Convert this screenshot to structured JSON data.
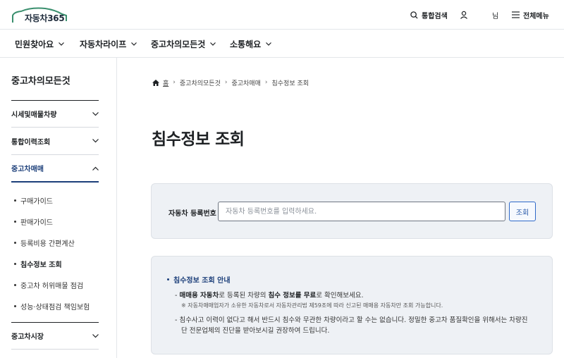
{
  "header": {
    "logo_text": "자동차365",
    "search_label": "통합검색",
    "user_name": "님",
    "menu_label": "전체메뉴"
  },
  "gnb": {
    "items": [
      {
        "label": "민원찾아요"
      },
      {
        "label": "자동차라이프"
      },
      {
        "label": "중고차의모든것"
      },
      {
        "label": "소통해요"
      }
    ]
  },
  "sidebar": {
    "title": "중고차의모든것",
    "sections": [
      {
        "label": "시세및매물차량"
      },
      {
        "label": "통합이력조회"
      },
      {
        "label": "중고차매매"
      },
      {
        "label": "중고차시장"
      }
    ],
    "sub_items": [
      {
        "label": "구매가이드"
      },
      {
        "label": "판매가이드"
      },
      {
        "label": "등록비용 간편계산"
      },
      {
        "label": "침수정보 조회"
      },
      {
        "label": "중고차 허위매물 점검"
      },
      {
        "label": "성능·상태점검 책임보험"
      }
    ]
  },
  "breadcrumb": {
    "items": [
      "홈",
      "중고차의모든것",
      "중고차매매",
      "침수정보 조회"
    ]
  },
  "page": {
    "title": "침수정보 조회"
  },
  "search": {
    "label": "자동차 등록번호",
    "placeholder": "자동차 등록번호를 입력하세요.",
    "button": "조회"
  },
  "guide": {
    "title": "침수정보 조회 안내",
    "line1": {
      "dash": "-",
      "p1": "매매용 자동차",
      "p2": "로 등록된 차량의 ",
      "p3": "침수 정보를 무료",
      "p4": "로 확인해보세요."
    },
    "note1": "※ 자동차매매업자가 소유한 자동차로서 자동차관리법 제59조에 따라 신고된 매매용 자동차만 조회 가능합니다.",
    "line2a": "- 침수사고 이력이 없다고 해서 반드시 침수와 무관한 차량이라고 할 수는 없습니다. 정밀한 중고차 품질확인을 위해서는 차량진",
    "line2b": "단 전문업체의 진단을 받아보시길 권장하여 드립니다."
  },
  "colors": {
    "accent": "#1c3f7a",
    "button_blue": "#2456a8",
    "panel_bg": "#eef1f5",
    "logo_green": "#3a8f6e"
  }
}
